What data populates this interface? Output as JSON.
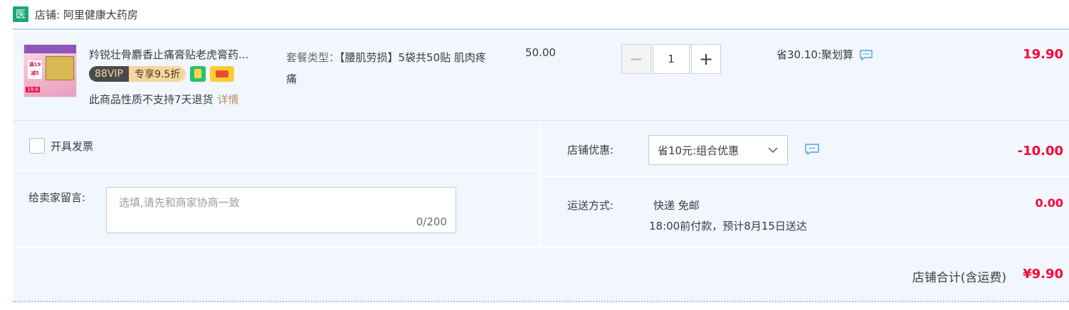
{
  "shop": {
    "badge": "医",
    "name": "店铺: 阿里健康大药房"
  },
  "item": {
    "title": "羚锐壮骨麝香止痛膏贴老虎膏药...",
    "thumb_tag": "满19减5",
    "thumb_price": "19.9",
    "vip_label": "88VIP",
    "vip_discount": "专享9.5折",
    "return_note": "此商品性质不支持7天退货",
    "return_link": "详情",
    "package_label": "套餐类型：",
    "package_value": "【腰肌劳损】5袋共50贴 肌肉疼痛",
    "unit_price": "50.00",
    "quantity": "1",
    "minus": "−",
    "plus": "+",
    "promo": "省30.10:聚划算",
    "price": "19.90"
  },
  "options": {
    "invoice_label": "开具发票",
    "message_label": "给卖家留言:",
    "message_placeholder": "选填,请先和商家协商一致",
    "message_count": "0/200",
    "shop_discount_label": "店铺优惠:",
    "shop_discount_selected": "省10元:组合优惠",
    "shop_discount_amount": "-10.00",
    "shipping_label": "运送方式:",
    "shipping_method": "快递 免邮",
    "shipping_eta": "18:00前付款，预计8月15日送达",
    "shipping_cost": "0.00"
  },
  "total": {
    "label": "店铺合计(含运费)",
    "value": "¥9.90"
  },
  "colors": {
    "accent_red": "#ff0036",
    "badge_green": "#1aa67c",
    "row_bg": "#f1f6ff",
    "rule_blue": "#b2d1ff"
  }
}
